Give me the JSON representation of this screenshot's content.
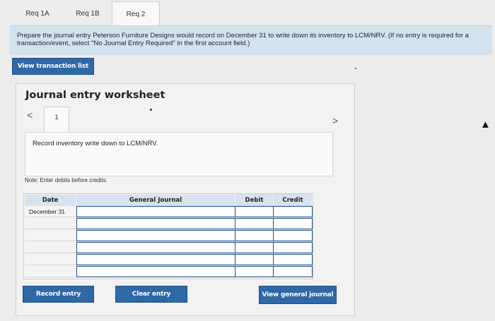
{
  "tabs": [
    "Req 1A",
    "Req 1B",
    "Req 2"
  ],
  "instructions": "Prepare the journal entry Peterson Furniture Designs would record on December 31 to write down its inventory to LCM/NRV. (If no entry is required for a transaction/event, select \"No Journal Entry Required\" in the first account field.)",
  "buttons": {
    "view_transaction": "View transaction list",
    "record": "Record entry",
    "clear": "Clear entry",
    "view_general": "View general journal"
  },
  "worksheet": {
    "title": "Journal entry worksheet",
    "prev": "<",
    "next": ">",
    "entry_number": "1",
    "description": "Record inventory write down to LCM/NRV.",
    "note": "Note: Enter debits before credits."
  },
  "table": {
    "headers": [
      "Date",
      "General Journal",
      "Debit",
      "Credit"
    ],
    "rows": [
      {
        "date": "December 31"
      },
      {
        "date": ""
      },
      {
        "date": ""
      },
      {
        "date": ""
      },
      {
        "date": ""
      },
      {
        "date": ""
      }
    ]
  }
}
